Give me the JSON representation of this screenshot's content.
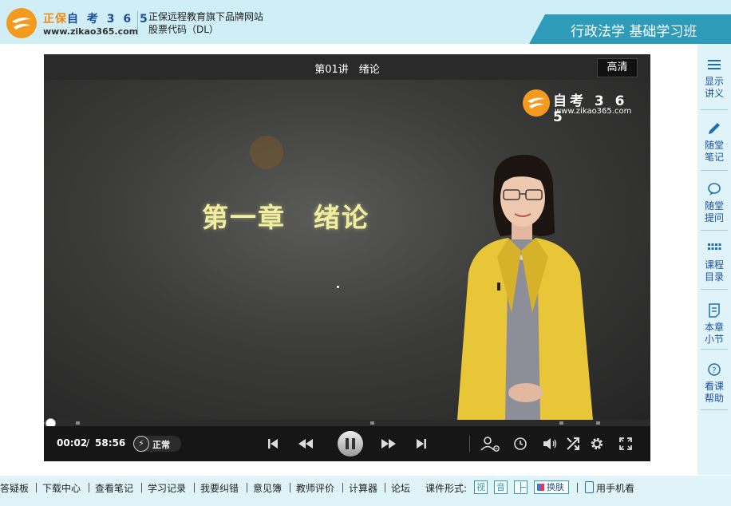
{
  "header": {
    "brand_cn": "正保",
    "brand_num": "自 考 3 6 5",
    "brand_url": "www.zikao365.com",
    "tagline_1": "正保远程教育旗下品牌网站",
    "tagline_2": "股票代码（DL）",
    "course_title": "行政法学 基础学习班",
    "accent_color": "#2e9bb8"
  },
  "player": {
    "lecture_title": "第01讲　绪论",
    "quality_label": "高清",
    "watermark_brand": "自考 3 6 5",
    "watermark_url": "www.zikao365.com",
    "slide": {
      "heading": "第一章　绪论"
    },
    "time_current": "00:02",
    "time_separator": "/",
    "time_total": "58:56",
    "speed_label": "正常",
    "progress_fraction": 0.0006
  },
  "sidebar": {
    "items": [
      {
        "label": "显示\n讲义",
        "icon": "menu-lines-icon"
      },
      {
        "label": "随堂\n笔记",
        "icon": "pencil-icon"
      },
      {
        "label": "随堂\n提问",
        "icon": "chat-bubble-icon"
      },
      {
        "label": "课程\n目录",
        "icon": "grid-icon"
      },
      {
        "label": "本章\n小节",
        "icon": "document-icon"
      },
      {
        "label": "看课\n帮助",
        "icon": "help-circle-icon"
      }
    ]
  },
  "footer": {
    "links": [
      "答疑板",
      "下载中心",
      "查看笔记",
      "学习记录",
      "我要纠错",
      "意见簿",
      "教师评价",
      "计算器",
      "论坛"
    ],
    "format_label": "课件形式:",
    "format_video": "视",
    "format_audio": "音",
    "skin_label": "换肤",
    "mobile_label": "用手机看"
  }
}
